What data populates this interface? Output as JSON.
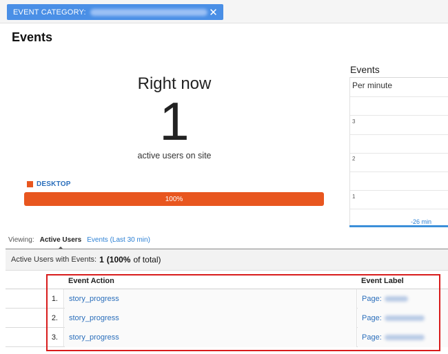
{
  "filter": {
    "label": "EVENT CATEGORY:",
    "close_glyph": "✕"
  },
  "page": {
    "title": "Events"
  },
  "right_now": {
    "title": "Right now",
    "count": "1",
    "subtitle": "active users on site"
  },
  "device": {
    "label": "DESKTOP",
    "percent_label": "100%",
    "share": 1.0,
    "color": "#e8561f"
  },
  "events_chart": {
    "title": "Events",
    "subtitle": "Per minute",
    "y_ticks": [
      "3",
      "2",
      "1"
    ],
    "x_tick": "-26 min"
  },
  "viewing": {
    "label": "Viewing:",
    "active_tab": "Active Users",
    "other_tab": "Events (Last 30 min)"
  },
  "summary": {
    "label": "Active Users with Events:",
    "count": "1",
    "percent": "(100%",
    "percent_rest": "of total)"
  },
  "table": {
    "headers": {
      "action": "Event Action",
      "label": "Event Label"
    },
    "rows": [
      {
        "num": "1.",
        "action": "story_progress",
        "label": "Page:"
      },
      {
        "num": "2.",
        "action": "story_progress",
        "label": "Page:"
      },
      {
        "num": "3.",
        "action": "story_progress",
        "label": "Page:"
      }
    ]
  },
  "colors": {
    "accent_blue": "#4a8fe6",
    "link_blue": "#2a6ebb",
    "desktop_orange": "#e8561f",
    "highlight_red": "#d81b1b"
  }
}
